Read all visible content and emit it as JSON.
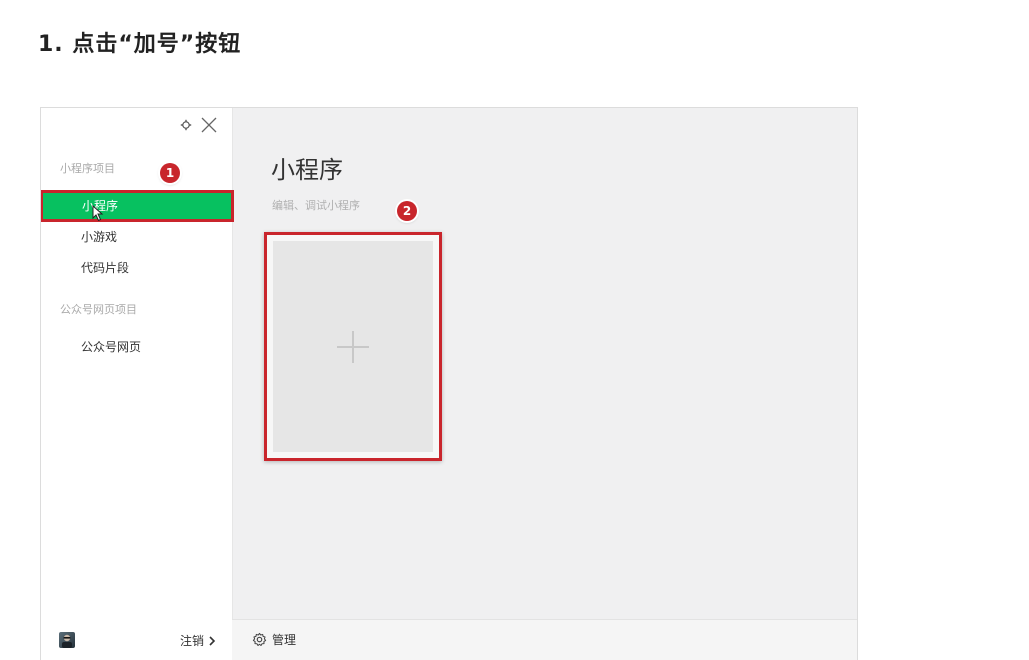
{
  "doc": {
    "heading": "1. 点击“加号”按钮"
  },
  "sidebar": {
    "section_miniprogram_label": "小程序项目",
    "items": [
      {
        "label": "小程序",
        "selected": true
      },
      {
        "label": "小游戏",
        "selected": false
      },
      {
        "label": "代码片段",
        "selected": false
      }
    ],
    "section_webpage_label": "公众号网页项目",
    "webpage_item": {
      "label": "公众号网页"
    },
    "logout_label": "注销"
  },
  "main": {
    "title": "小程序",
    "subtitle": "编辑、调试小程序",
    "manage_label": "管理"
  },
  "annotations": {
    "badge_1": "1",
    "badge_2": "2"
  },
  "icons": {
    "settings": "settings-icon",
    "close": "close-icon",
    "cursor": "cursor-icon",
    "plus": "plus-icon",
    "gear": "gear-icon",
    "chevron": "chevron-right-icon",
    "avatar": "avatar"
  },
  "colors": {
    "accent": "#07c160",
    "highlight": "#c9252c"
  }
}
